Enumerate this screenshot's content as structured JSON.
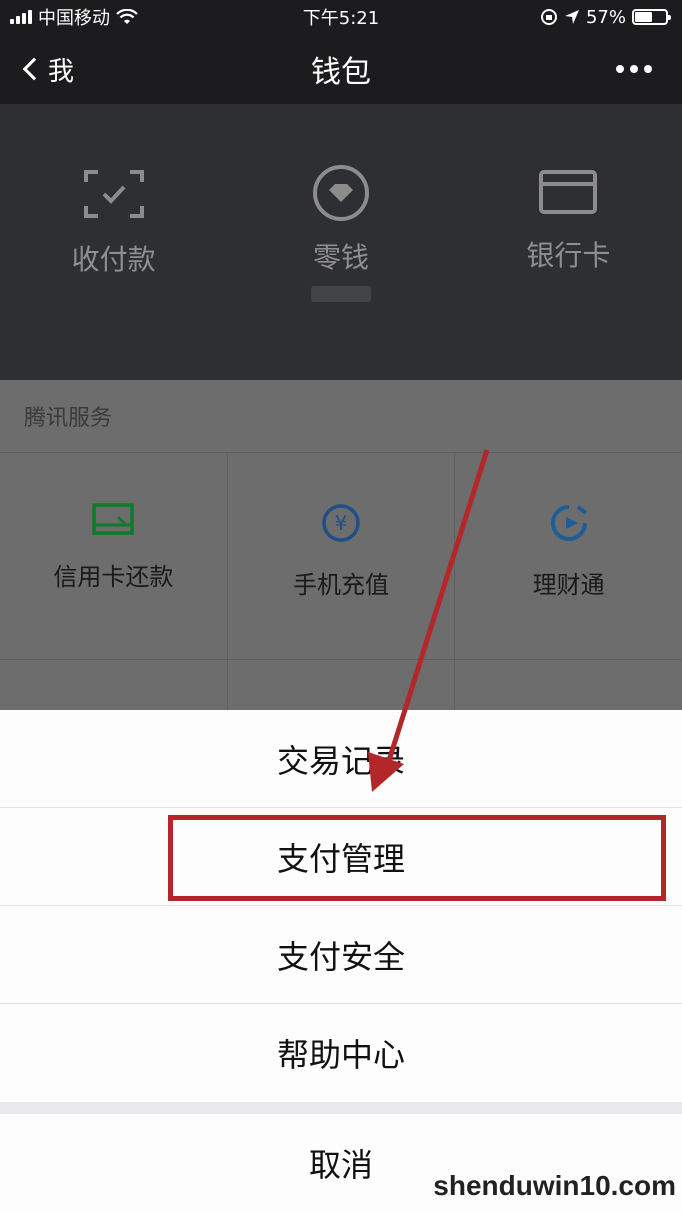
{
  "status": {
    "carrier": "中国移动",
    "time": "下午5:21",
    "battery": "57%",
    "battery_level": 0.57
  },
  "nav": {
    "back_label": "我",
    "title": "钱包"
  },
  "wallet": {
    "items": [
      {
        "label": "收付款",
        "icon": "scan-pay-icon"
      },
      {
        "label": "零钱",
        "icon": "change-icon"
      },
      {
        "label": "银行卡",
        "icon": "bank-card-icon"
      }
    ]
  },
  "services": {
    "title": "腾讯服务",
    "items": [
      {
        "label": "信用卡还款",
        "icon": "credit-card-repay-icon",
        "color": "#1aad19"
      },
      {
        "label": "手机充值",
        "icon": "mobile-recharge-icon",
        "color": "#2b6cb0"
      },
      {
        "label": "理财通",
        "icon": "wealth-icon",
        "color": "#1f6fb2"
      }
    ]
  },
  "action_sheet": {
    "items": [
      "交易记录",
      "支付管理",
      "支付安全",
      "帮助中心"
    ],
    "cancel": "取消"
  },
  "highlight_color": "#b3262a",
  "watermark": "shenduwin10.com"
}
